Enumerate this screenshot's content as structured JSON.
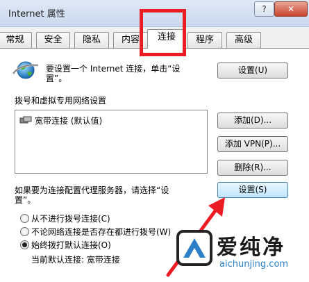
{
  "window": {
    "title": "Internet 属性",
    "help_label": "?",
    "close_label": "✕"
  },
  "tabs": [
    {
      "label": "常规"
    },
    {
      "label": "安全"
    },
    {
      "label": "隐私"
    },
    {
      "label": "内容"
    },
    {
      "label": "连接",
      "active": true
    },
    {
      "label": "程序"
    },
    {
      "label": "高级"
    }
  ],
  "connection": {
    "setup_text_line1": "要设置一个 Internet 连接，单击“设",
    "setup_text_line2": "置”。",
    "setup_button": "设置(U)",
    "dialup_section_label": "拨号和虚拟专用网络设置",
    "dialup_items": [
      {
        "label": "宽带连接 (默认值)"
      }
    ],
    "add_button": "添加(D)...",
    "add_vpn_button": "添加 VPN(P)...",
    "remove_button": "删除(R)...",
    "proxy_text_line1": "如果要为连接配置代理服务器，请选择“设",
    "proxy_text_line2": "置”。",
    "settings_button": "设置(S)",
    "radio_options": [
      {
        "label": "从不进行拨号连接(C)",
        "checked": false
      },
      {
        "label": "不论网络连接是否存在都进行拨号(W)",
        "checked": false
      },
      {
        "label": "始终拨打默认连接(O)",
        "checked": true
      }
    ],
    "current_default_label": "当前默认连接: 宽带连接"
  },
  "annotation": {
    "highlight_color": "#ec1c24",
    "arrow_color": "#ec1c24"
  },
  "watermark": {
    "name": "爱纯净",
    "url": "aichunjing.com"
  }
}
